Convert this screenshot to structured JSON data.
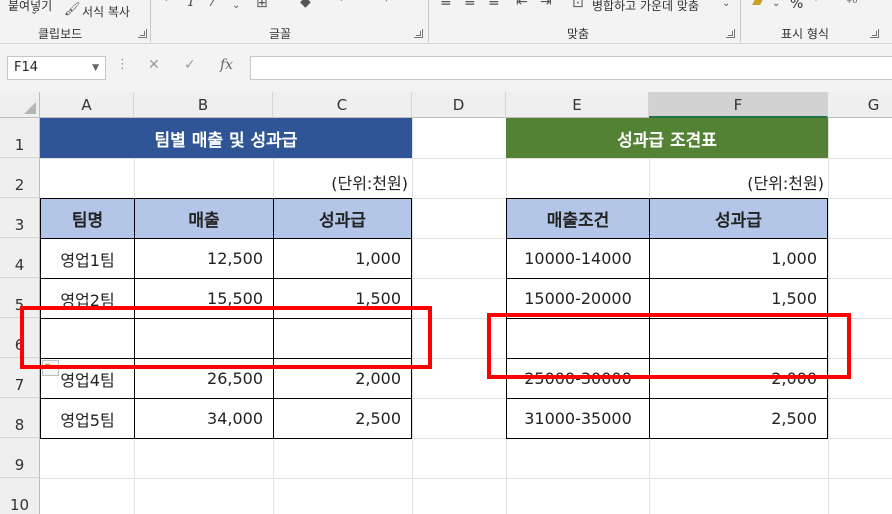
{
  "ribbon": {
    "groups": [
      {
        "label": "클립보드"
      },
      {
        "label": "글꼴"
      },
      {
        "label": "맞춤"
      },
      {
        "label": "표시 형식"
      }
    ],
    "clipboard_top": "붙여넣기",
    "format_painter": "서식 복사",
    "merge_center": "병합하고 가운데 맞춤",
    "percent": "%"
  },
  "formula_bar": {
    "name_box": "F14",
    "formula": "",
    "cancel_glyph": "✕",
    "enter_glyph": "✓",
    "fx_glyph": "fx"
  },
  "columns": [
    "A",
    "B",
    "C",
    "D",
    "E",
    "F",
    "G"
  ],
  "rows": [
    "1",
    "2",
    "3",
    "4",
    "5",
    "6",
    "7",
    "8",
    "9",
    "10"
  ],
  "colors": {
    "title_left_bg": "#2f5597",
    "title_right_bg": "#548235",
    "header_bg": "#b4c6e7",
    "highlight": "#ff0000",
    "selected_col_accent": "#217346"
  },
  "left_table": {
    "title": "팀별 매출 및 성과급",
    "unit": "(단위:천원)",
    "headers": [
      "팀명",
      "매출",
      "성과급"
    ],
    "rows": [
      [
        "영업1팀",
        "12,500",
        "1,000"
      ],
      [
        "영업2팀",
        "15,500",
        "1,500"
      ],
      [
        "",
        "",
        ""
      ],
      [
        "영업4팀",
        "26,500",
        "2,000"
      ],
      [
        "영업5팀",
        "34,000",
        "2,500"
      ]
    ]
  },
  "right_table": {
    "title": "성과급 조견표",
    "unit": "(단위:천원)",
    "headers": [
      "매출조건",
      "성과급"
    ],
    "rows": [
      [
        "10000-14000",
        "1,000"
      ],
      [
        "15000-20000",
        "1,500"
      ],
      [
        "",
        ""
      ],
      [
        "25000-30000",
        "2,000"
      ],
      [
        "31000-35000",
        "2,500"
      ]
    ]
  }
}
